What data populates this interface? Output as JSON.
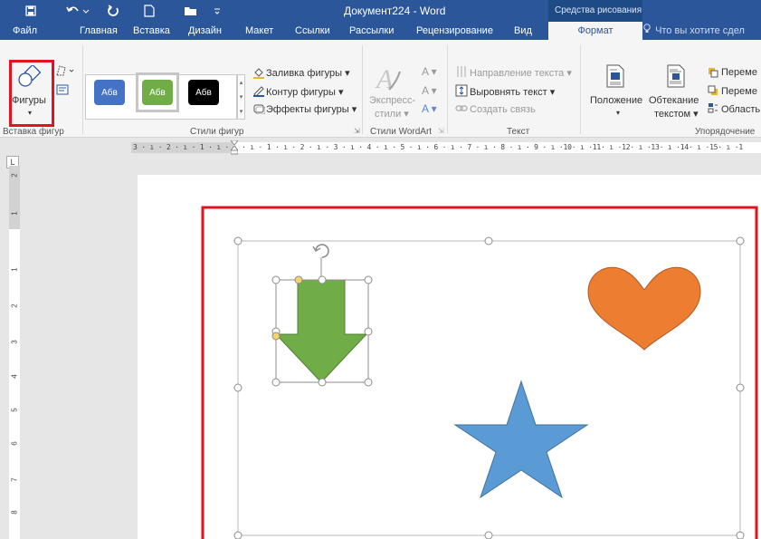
{
  "title_bar": {
    "document_title": "Документ224 - Word",
    "contextual_tools": "Средства рисования",
    "quick_access": [
      "save-icon",
      "undo-icon",
      "redo-icon",
      "new-doc-icon",
      "open-icon",
      "customize-icon"
    ]
  },
  "tabs": [
    "Файл",
    "Главная",
    "Вставка",
    "Дизайн",
    "Макет",
    "Ссылки",
    "Рассылки",
    "Рецензирование",
    "Вид",
    "Формат"
  ],
  "active_tab": "Формат",
  "tell_me": "Что вы хотите сдел",
  "ribbon": {
    "insert_shapes": {
      "shapes_button": "Фигуры",
      "group_label": "Вставка фигур"
    },
    "shape_styles": {
      "swatches": [
        {
          "label": "Абв",
          "color": "#4472c4"
        },
        {
          "label": "Абв",
          "color": "#70ad47"
        },
        {
          "label": "Абв",
          "color": "#000000"
        }
      ],
      "fill": "Заливка фигуры",
      "outline": "Контур фигуры",
      "effects": "Эффекты фигуры",
      "group_label": "Стили фигур"
    },
    "wordart": {
      "express_styles": "Экспресс-",
      "express_styles_2": "стили",
      "group_label": "Стили WordArt"
    },
    "text": {
      "direction": "Направление текста",
      "align": "Выровнять текст",
      "link": "Создать связь",
      "group_label": "Текст"
    },
    "arrange": {
      "position": "Положение",
      "wrap": "Обтекание",
      "wrap_2": "текстом",
      "forward": "Переме",
      "backward": "Переме",
      "selection": "Область",
      "group_label": "Упорядочение"
    }
  },
  "ruler": {
    "horizontal": "3 · ı · 2 · ı · 1 · ı · ·  · ı · 1 · ı · 2 · ı · 3 · ı · 4 · ı · 5 · ı · 6 · ı · 7 · ı · 8 · ı · 9 · ı ·10· ı ·11· ı ·12· ı ·13· ı ·14· ı ·15· ı ·1",
    "vertical": [
      "2",
      "1",
      "1",
      "2",
      "3",
      "4",
      "5",
      "6",
      "7",
      "8"
    ]
  },
  "colors": {
    "accent": "#2b579a",
    "arrow_fill": "#70ad47",
    "heart_fill": "#ed7d31",
    "star_fill": "#5b9bd5",
    "highlight": "#e0141e"
  }
}
